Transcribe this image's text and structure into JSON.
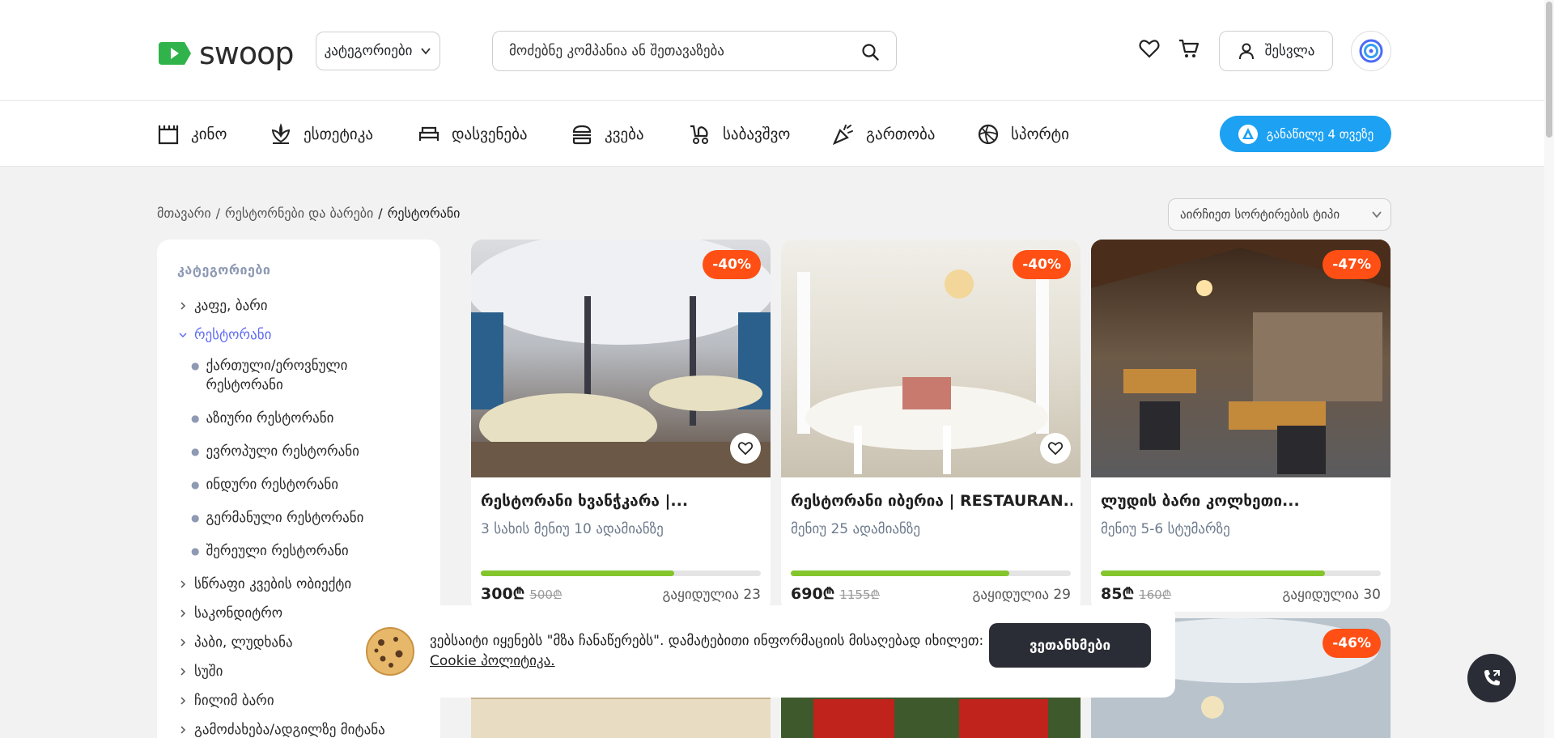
{
  "header": {
    "logo_text": "swoop",
    "categories_label": "კატეგორიები",
    "search_placeholder": "მოძებნე კომპანია ან შეთავაზება",
    "login_label": "შესვლა"
  },
  "nav": {
    "items": [
      {
        "label": "კინო",
        "icon": "cinema-icon"
      },
      {
        "label": "ესთეტიკა",
        "icon": "beauty-icon"
      },
      {
        "label": "დასვენება",
        "icon": "bed-icon"
      },
      {
        "label": "კვება",
        "icon": "burger-icon"
      },
      {
        "label": "საბავშვო",
        "icon": "stroller-icon"
      },
      {
        "label": "გართობა",
        "icon": "party-icon"
      },
      {
        "label": "სპორტი",
        "icon": "ball-icon"
      }
    ],
    "install_label": "განაწილე 4 თვეზე"
  },
  "breadcrumb": {
    "items": [
      "მთავარი",
      "რესტორნები და ბარები"
    ],
    "current": "რესტორანი"
  },
  "sort": {
    "placeholder": "აირჩიეთ სორტირების ტიპი"
  },
  "sidebar": {
    "title": "კატეგორიები",
    "items": [
      "კაფე, ბარი",
      "რესტორანი",
      "სწრაფი კვების ობიექტი",
      "საკონდიტრო",
      "პაბი, ლუდხანა",
      "სუში",
      "ჩილიმ ბარი",
      "გამოძახება/ადგილზე მიტანა"
    ],
    "active_index": 1,
    "subitems": [
      "ქართული/ეროვნული რესტორანი",
      "აზიური რესტორანი",
      "ევროპული რესტორანი",
      "ინდური რესტორანი",
      "გერმანული რესტორანი",
      "შერეული რესტორანი"
    ]
  },
  "cards": [
    {
      "discount": "-40%",
      "title": "რესტორანი ხვანჭკარა |...",
      "subtitle": "3 სახის მენიუ 10 ადამიანზე",
      "price": "300₾",
      "old_price": "500₾",
      "sold": "გაყიდულია 23",
      "progress": 0.69
    },
    {
      "discount": "-40%",
      "title": "რესტორანი იბერია | RESTAURAN...",
      "subtitle": "მენიუ 25 ადამიანზე",
      "price": "690₾",
      "old_price": "1155₾",
      "sold": "გაყიდულია 29",
      "progress": 0.78
    },
    {
      "discount": "-47%",
      "title": "ლუდის ბარი კოლხეთი...",
      "subtitle": "მენიუ 5-6 სტუმარზე",
      "price": "85₾",
      "old_price": "160₾",
      "sold": "გაყიდულია 30",
      "progress": 0.8
    }
  ],
  "cards_row2": [
    {
      "discount": "-46%"
    }
  ],
  "cookie": {
    "text": "ვებსაიტი იყენებს \"მზა ჩანაწერებს\". დამატებითი ინფორმაციის მისაღებად იხილეთ:",
    "link": "Cookie პოლიტიკა.",
    "accept_label": "ვეთანხმები"
  },
  "colors": {
    "accent": "#1da1f2",
    "discount": "#ff4f14",
    "progress": "#84c52c",
    "active_category": "#5f6cf2",
    "dark_button": "#2b2d36"
  }
}
